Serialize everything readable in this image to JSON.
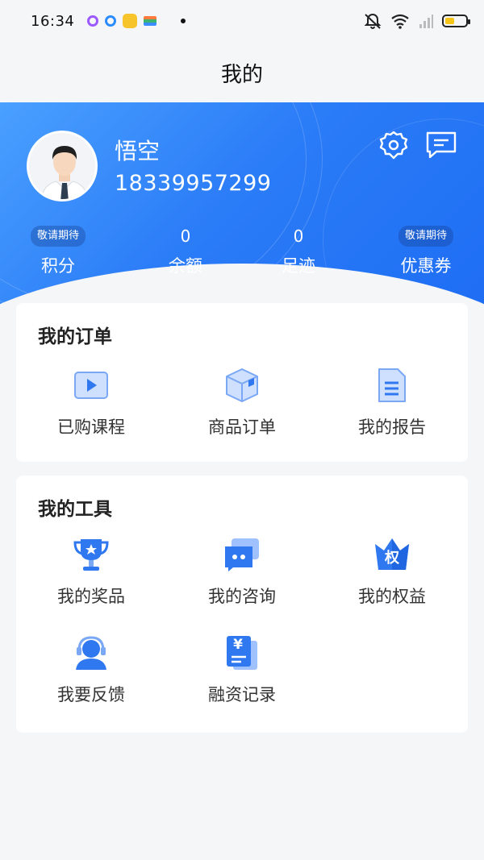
{
  "status_bar": {
    "time": "16:34"
  },
  "header": {
    "title": "我的"
  },
  "profile": {
    "name": "悟空",
    "phone": "18339957299"
  },
  "stats": [
    {
      "badge": "敬请期待",
      "value": "",
      "label": "积分"
    },
    {
      "badge": "",
      "value": "0",
      "label": "余额"
    },
    {
      "badge": "",
      "value": "0",
      "label": "足迹"
    },
    {
      "badge": "敬请期待",
      "value": "",
      "label": "优惠券"
    }
  ],
  "orders": {
    "title": "我的订单",
    "items": [
      {
        "label": "已购课程",
        "icon": "video-icon"
      },
      {
        "label": "商品订单",
        "icon": "box-icon"
      },
      {
        "label": "我的报告",
        "icon": "document-icon"
      }
    ]
  },
  "tools": {
    "title": "我的工具",
    "items": [
      {
        "label": "我的奖品",
        "icon": "trophy-icon"
      },
      {
        "label": "我的咨询",
        "icon": "chat-icon"
      },
      {
        "label": "我的权益",
        "icon": "crown-icon",
        "glyph": "权"
      },
      {
        "label": "我要反馈",
        "icon": "headset-icon"
      },
      {
        "label": "融资记录",
        "icon": "finance-icon",
        "glyph": "¥"
      }
    ]
  },
  "colors": {
    "accent": "#1d6cf4",
    "icon_blue": "#2f78f0",
    "icon_light": "#9fc2ff"
  }
}
